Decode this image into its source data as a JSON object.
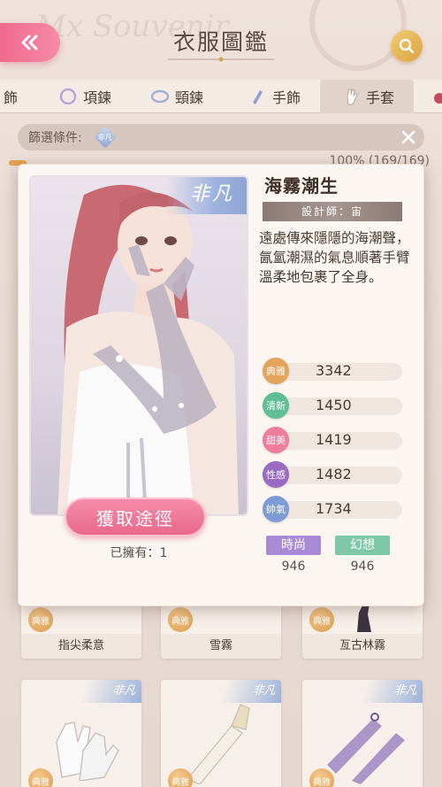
{
  "header": {
    "title": "衣服圖鑑",
    "watermark": "Mx Souvenir"
  },
  "tabs": [
    {
      "label": "飾",
      "icon": "bracelet-icon"
    },
    {
      "label": "項鍊",
      "icon": "necklace-icon"
    },
    {
      "label": "頸鍊",
      "icon": "choker-icon"
    },
    {
      "label": "手飾",
      "icon": "hand-ornament-icon"
    },
    {
      "label": "手套",
      "icon": "glove-icon",
      "active": true
    }
  ],
  "filter": {
    "label": "篩選條件:",
    "chip": "非凡"
  },
  "progress": "100% (169/169)",
  "detail": {
    "rarity": "非凡",
    "name": "海霧潮生",
    "designer": "設計師：宙",
    "description": "遠處傳來隱隱的海潮聲，氤氳潮濕的氣息順著手臂溫柔地包裹了全身。",
    "acquire_label": "獲取途徑",
    "owned_label": "已擁有：1",
    "stats": [
      {
        "label": "典雅",
        "value": "3342",
        "color": "#e3a45c"
      },
      {
        "label": "清新",
        "value": "1450",
        "color": "#5ebf97"
      },
      {
        "label": "甜美",
        "value": "1419",
        "color": "#ee7d9c"
      },
      {
        "label": "性感",
        "value": "1482",
        "color": "#9a6bc2"
      },
      {
        "label": "帥氣",
        "value": "1734",
        "color": "#7e9bd8"
      }
    ],
    "tags": [
      {
        "label": "時尚",
        "value": "946",
        "color": "#a98ad6"
      },
      {
        "label": "幻想",
        "value": "946",
        "color": "#7ec8a8"
      }
    ]
  },
  "grid": [
    {
      "name": "指尖柔意",
      "badge": "典雅"
    },
    {
      "name": "雪霧",
      "badge": "典雅"
    },
    {
      "name": "亙古林霧",
      "badge": "典雅"
    },
    {
      "name": "",
      "badge": "典雅",
      "rarity": "非凡"
    },
    {
      "name": "",
      "badge": "典雅",
      "rarity": "非凡"
    },
    {
      "name": "",
      "badge": "典雅",
      "rarity": "非凡"
    }
  ]
}
